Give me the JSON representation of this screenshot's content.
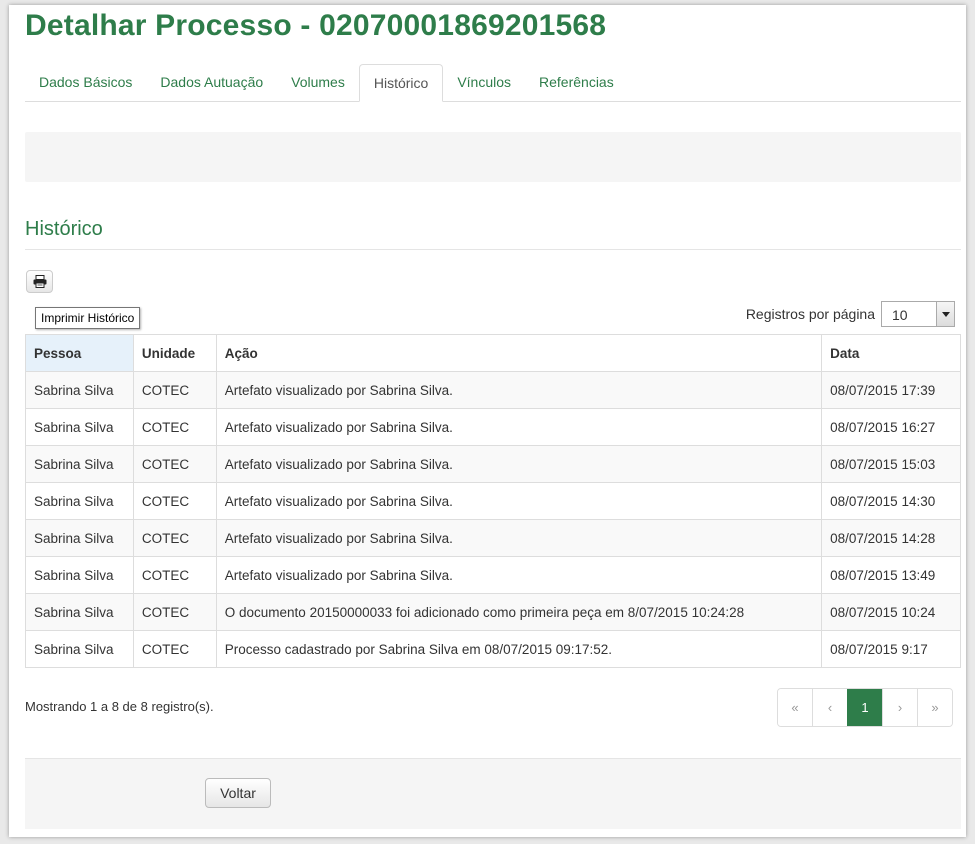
{
  "page": {
    "title": "Detalhar Processo - 02070001869201568",
    "tabs": [
      "Dados Básicos",
      "Dados Autuação",
      "Volumes",
      "Histórico",
      "Vínculos",
      "Referências"
    ],
    "active_tab": "Histórico",
    "section_title": "Histórico"
  },
  "toolbar": {
    "print_icon": "printer-icon",
    "print_tooltip": "Imprimir Histórico"
  },
  "page_size": {
    "label": "Registros por página",
    "value": "10"
  },
  "table": {
    "headers": [
      "Pessoa",
      "Unidade",
      "Ação",
      "Data"
    ],
    "sorted_column": "Pessoa",
    "rows": [
      [
        "Sabrina Silva",
        "COTEC",
        "Artefato visualizado por Sabrina Silva.",
        "08/07/2015 17:39"
      ],
      [
        "Sabrina Silva",
        "COTEC",
        "Artefato visualizado por Sabrina Silva.",
        "08/07/2015 16:27"
      ],
      [
        "Sabrina Silva",
        "COTEC",
        "Artefato visualizado por Sabrina Silva.",
        "08/07/2015 15:03"
      ],
      [
        "Sabrina Silva",
        "COTEC",
        "Artefato visualizado por Sabrina Silva.",
        "08/07/2015 14:30"
      ],
      [
        "Sabrina Silva",
        "COTEC",
        "Artefato visualizado por Sabrina Silva.",
        "08/07/2015 14:28"
      ],
      [
        "Sabrina Silva",
        "COTEC",
        "Artefato visualizado por Sabrina Silva.",
        "08/07/2015 13:49"
      ],
      [
        "Sabrina Silva",
        "COTEC",
        "O documento 20150000033 foi adicionado como primeira peça em 8/07/2015 10:24:28",
        "08/07/2015 10:24"
      ],
      [
        "Sabrina Silva",
        "COTEC",
        "Processo cadastrado por Sabrina Silva em 08/07/2015 09:17:52.",
        "08/07/2015 9:17"
      ]
    ]
  },
  "pagination": {
    "summary": "Mostrando 1 a 8 de 8 registro(s).",
    "first": "«",
    "prev": "‹",
    "current": "1",
    "next": "›",
    "last": "»"
  },
  "footer": {
    "back_label": "Voltar"
  },
  "colors": {
    "accent": "#2e7d4a",
    "sorted_header": "#e6f1fa"
  }
}
